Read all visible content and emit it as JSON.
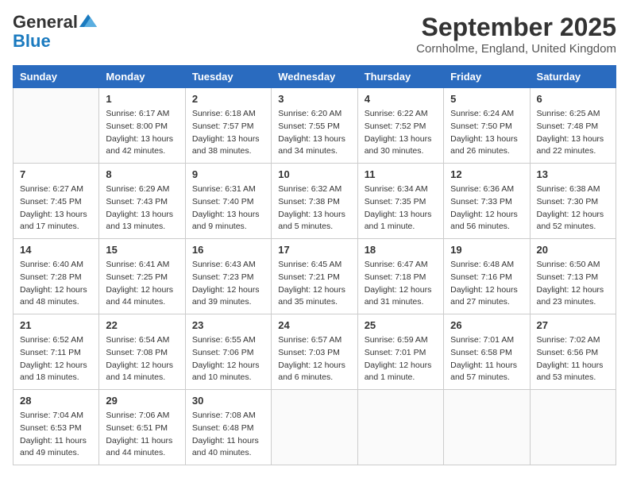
{
  "header": {
    "logo_general": "General",
    "logo_blue": "Blue",
    "month": "September 2025",
    "location": "Cornholme, England, United Kingdom"
  },
  "weekdays": [
    "Sunday",
    "Monday",
    "Tuesday",
    "Wednesday",
    "Thursday",
    "Friday",
    "Saturday"
  ],
  "weeks": [
    [
      {
        "day": "",
        "info": ""
      },
      {
        "day": "1",
        "info": "Sunrise: 6:17 AM\nSunset: 8:00 PM\nDaylight: 13 hours\nand 42 minutes."
      },
      {
        "day": "2",
        "info": "Sunrise: 6:18 AM\nSunset: 7:57 PM\nDaylight: 13 hours\nand 38 minutes."
      },
      {
        "day": "3",
        "info": "Sunrise: 6:20 AM\nSunset: 7:55 PM\nDaylight: 13 hours\nand 34 minutes."
      },
      {
        "day": "4",
        "info": "Sunrise: 6:22 AM\nSunset: 7:52 PM\nDaylight: 13 hours\nand 30 minutes."
      },
      {
        "day": "5",
        "info": "Sunrise: 6:24 AM\nSunset: 7:50 PM\nDaylight: 13 hours\nand 26 minutes."
      },
      {
        "day": "6",
        "info": "Sunrise: 6:25 AM\nSunset: 7:48 PM\nDaylight: 13 hours\nand 22 minutes."
      }
    ],
    [
      {
        "day": "7",
        "info": "Sunrise: 6:27 AM\nSunset: 7:45 PM\nDaylight: 13 hours\nand 17 minutes."
      },
      {
        "day": "8",
        "info": "Sunrise: 6:29 AM\nSunset: 7:43 PM\nDaylight: 13 hours\nand 13 minutes."
      },
      {
        "day": "9",
        "info": "Sunrise: 6:31 AM\nSunset: 7:40 PM\nDaylight: 13 hours\nand 9 minutes."
      },
      {
        "day": "10",
        "info": "Sunrise: 6:32 AM\nSunset: 7:38 PM\nDaylight: 13 hours\nand 5 minutes."
      },
      {
        "day": "11",
        "info": "Sunrise: 6:34 AM\nSunset: 7:35 PM\nDaylight: 13 hours\nand 1 minute."
      },
      {
        "day": "12",
        "info": "Sunrise: 6:36 AM\nSunset: 7:33 PM\nDaylight: 12 hours\nand 56 minutes."
      },
      {
        "day": "13",
        "info": "Sunrise: 6:38 AM\nSunset: 7:30 PM\nDaylight: 12 hours\nand 52 minutes."
      }
    ],
    [
      {
        "day": "14",
        "info": "Sunrise: 6:40 AM\nSunset: 7:28 PM\nDaylight: 12 hours\nand 48 minutes."
      },
      {
        "day": "15",
        "info": "Sunrise: 6:41 AM\nSunset: 7:25 PM\nDaylight: 12 hours\nand 44 minutes."
      },
      {
        "day": "16",
        "info": "Sunrise: 6:43 AM\nSunset: 7:23 PM\nDaylight: 12 hours\nand 39 minutes."
      },
      {
        "day": "17",
        "info": "Sunrise: 6:45 AM\nSunset: 7:21 PM\nDaylight: 12 hours\nand 35 minutes."
      },
      {
        "day": "18",
        "info": "Sunrise: 6:47 AM\nSunset: 7:18 PM\nDaylight: 12 hours\nand 31 minutes."
      },
      {
        "day": "19",
        "info": "Sunrise: 6:48 AM\nSunset: 7:16 PM\nDaylight: 12 hours\nand 27 minutes."
      },
      {
        "day": "20",
        "info": "Sunrise: 6:50 AM\nSunset: 7:13 PM\nDaylight: 12 hours\nand 23 minutes."
      }
    ],
    [
      {
        "day": "21",
        "info": "Sunrise: 6:52 AM\nSunset: 7:11 PM\nDaylight: 12 hours\nand 18 minutes."
      },
      {
        "day": "22",
        "info": "Sunrise: 6:54 AM\nSunset: 7:08 PM\nDaylight: 12 hours\nand 14 minutes."
      },
      {
        "day": "23",
        "info": "Sunrise: 6:55 AM\nSunset: 7:06 PM\nDaylight: 12 hours\nand 10 minutes."
      },
      {
        "day": "24",
        "info": "Sunrise: 6:57 AM\nSunset: 7:03 PM\nDaylight: 12 hours\nand 6 minutes."
      },
      {
        "day": "25",
        "info": "Sunrise: 6:59 AM\nSunset: 7:01 PM\nDaylight: 12 hours\nand 1 minute."
      },
      {
        "day": "26",
        "info": "Sunrise: 7:01 AM\nSunset: 6:58 PM\nDaylight: 11 hours\nand 57 minutes."
      },
      {
        "day": "27",
        "info": "Sunrise: 7:02 AM\nSunset: 6:56 PM\nDaylight: 11 hours\nand 53 minutes."
      }
    ],
    [
      {
        "day": "28",
        "info": "Sunrise: 7:04 AM\nSunset: 6:53 PM\nDaylight: 11 hours\nand 49 minutes."
      },
      {
        "day": "29",
        "info": "Sunrise: 7:06 AM\nSunset: 6:51 PM\nDaylight: 11 hours\nand 44 minutes."
      },
      {
        "day": "30",
        "info": "Sunrise: 7:08 AM\nSunset: 6:48 PM\nDaylight: 11 hours\nand 40 minutes."
      },
      {
        "day": "",
        "info": ""
      },
      {
        "day": "",
        "info": ""
      },
      {
        "day": "",
        "info": ""
      },
      {
        "day": "",
        "info": ""
      }
    ]
  ]
}
